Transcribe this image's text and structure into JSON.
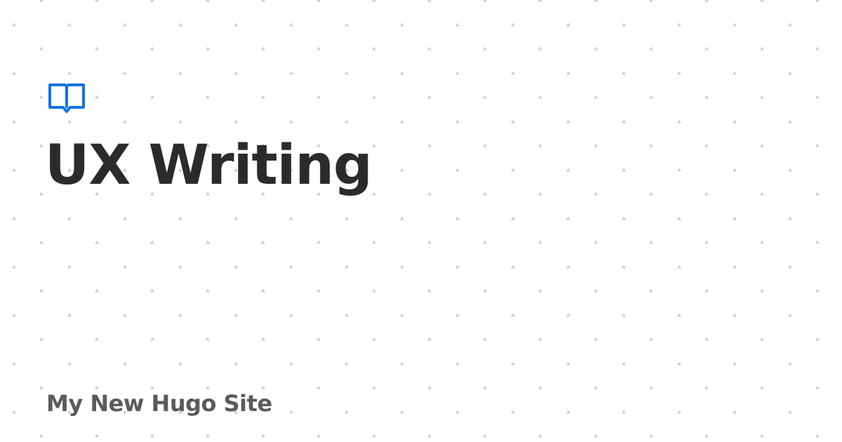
{
  "page": {
    "title": "UX Writing",
    "site_name": "My New Hugo Site"
  },
  "icons": {
    "logo": "open-book-icon"
  },
  "colors": {
    "background": "#ffffff",
    "accent": "#1473e6",
    "title": "#2b2b2b",
    "site_name": "#5b5b5b",
    "pattern": "#cfcfcf"
  }
}
